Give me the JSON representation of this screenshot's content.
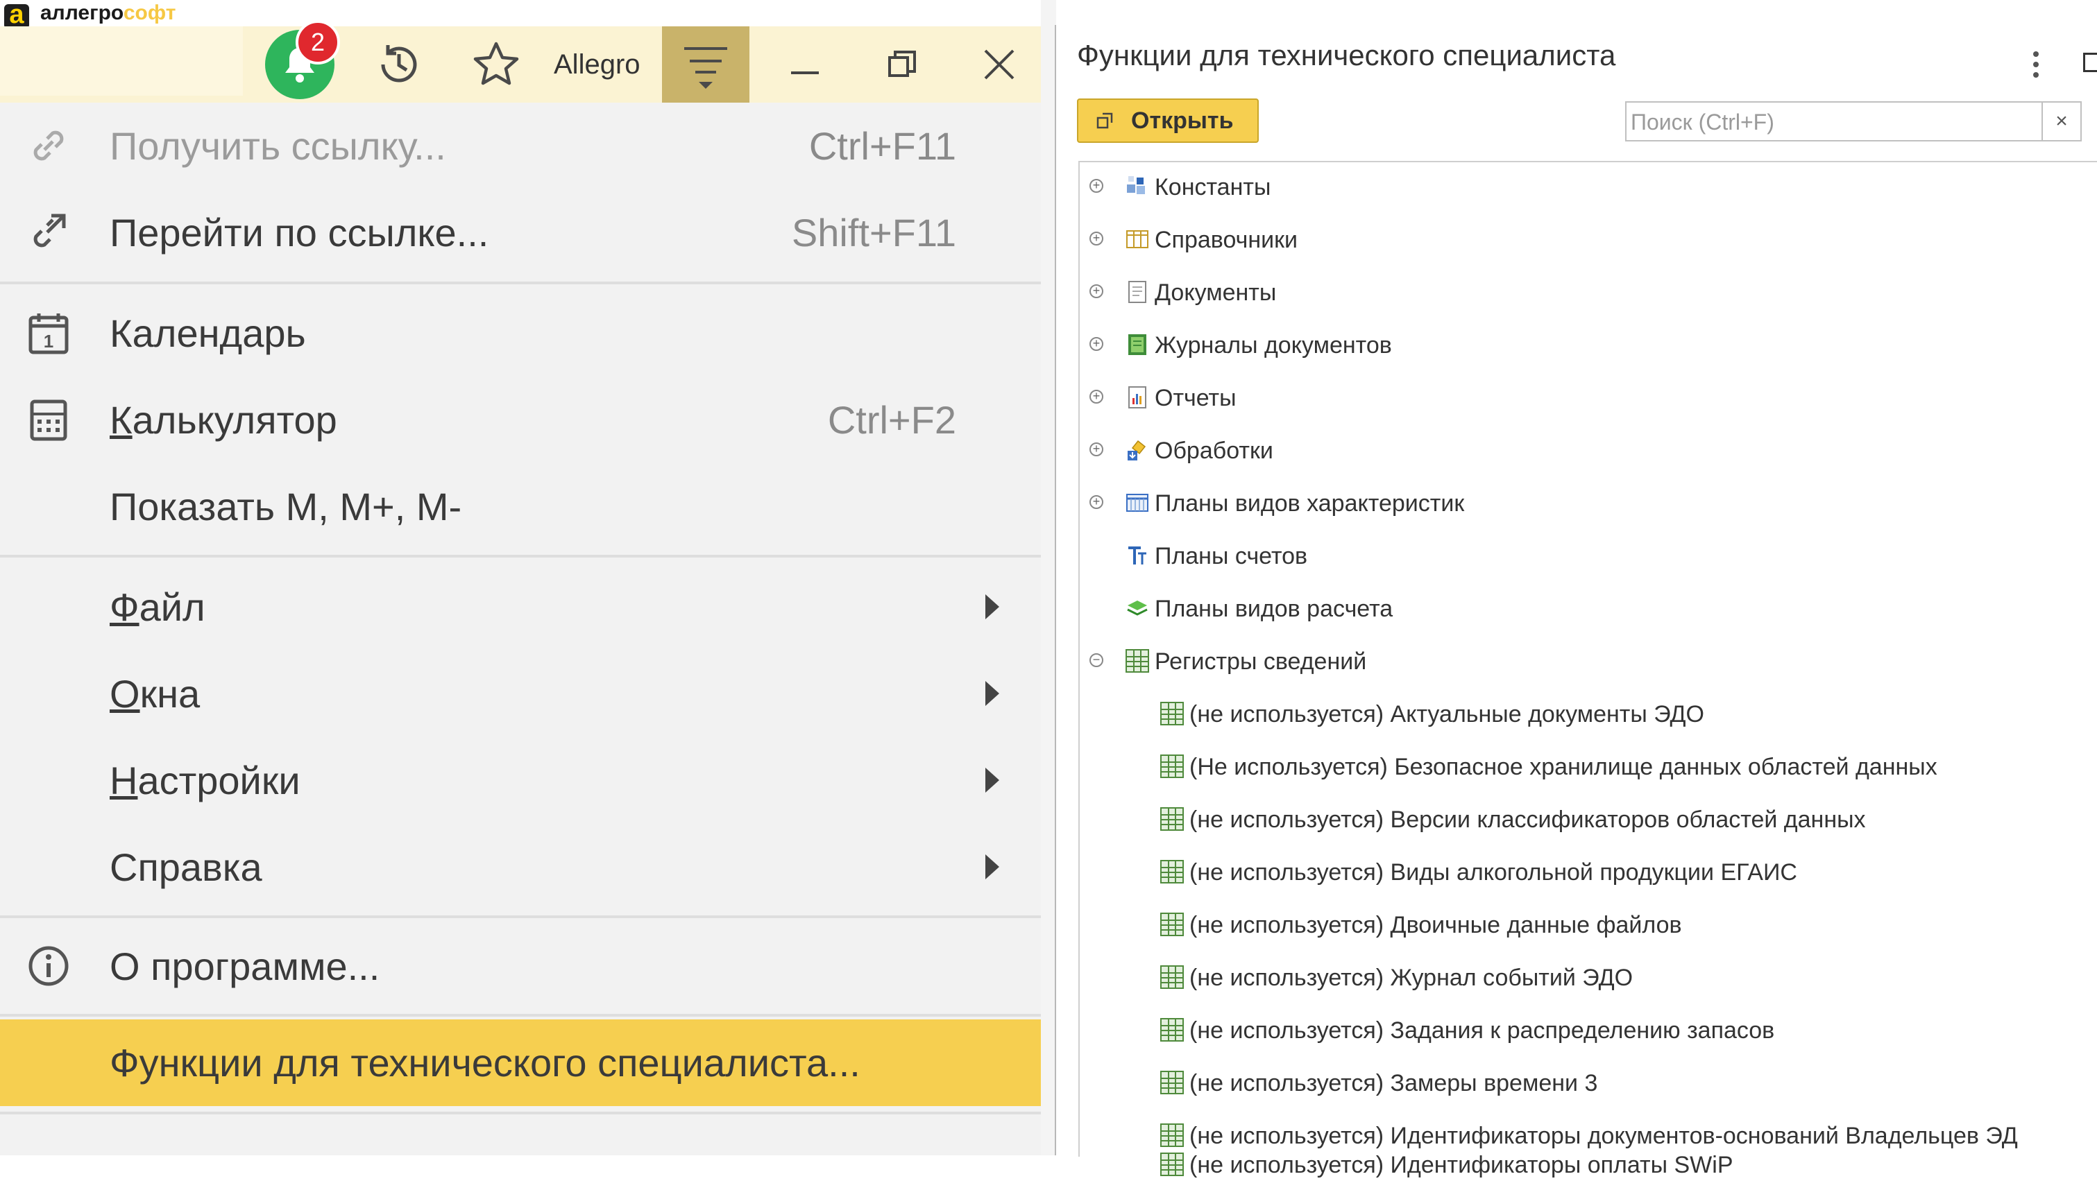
{
  "brand": {
    "logo_glyph": "a",
    "name_main": "аллегро",
    "name_accent": "софт"
  },
  "toolbar": {
    "notifications_count": "2",
    "app_label": "Allegro"
  },
  "menu": {
    "items": [
      {
        "label": "Получить ссылку...",
        "shortcut": "Ctrl+F11",
        "icon": "link-icon"
      },
      {
        "label": "Перейти по ссылке...",
        "shortcut": "Shift+F11",
        "icon": "follow-link-icon"
      },
      {
        "label": "Календарь",
        "shortcut": "",
        "icon": "calendar-icon"
      },
      {
        "label": "Калькулятор",
        "shortcut": "Ctrl+F2",
        "icon": "calculator-icon"
      },
      {
        "label": "Показать M, M+, M-",
        "shortcut": "",
        "icon": ""
      },
      {
        "label": "Файл",
        "submenu": true
      },
      {
        "label": "Окна",
        "submenu": true
      },
      {
        "label": "Настройки",
        "submenu": true
      },
      {
        "label": "Справка",
        "submenu": true
      },
      {
        "label": "О программе...",
        "icon": "info-icon"
      },
      {
        "label": "Функции для технического специалиста..."
      }
    ]
  },
  "panel": {
    "title": "Функции для технического специалиста",
    "open_button": "Открыть",
    "search_placeholder": "Поиск (Ctrl+F)",
    "search_clear": "×",
    "tree": [
      {
        "label": "Константы",
        "expand": "+",
        "icon": "constants-icon"
      },
      {
        "label": "Справочники",
        "expand": "+",
        "icon": "catalogs-icon"
      },
      {
        "label": "Документы",
        "expand": "+",
        "icon": "documents-icon"
      },
      {
        "label": "Журналы документов",
        "expand": "+",
        "icon": "journals-icon"
      },
      {
        "label": "Отчеты",
        "expand": "+",
        "icon": "reports-icon"
      },
      {
        "label": "Обработки",
        "expand": "+",
        "icon": "processing-icon"
      },
      {
        "label": "Планы видов характеристик",
        "expand": "+",
        "icon": "characteristics-icon"
      },
      {
        "label": "Планы счетов",
        "expand": "",
        "icon": "chart-of-accounts-icon"
      },
      {
        "label": "Планы видов расчета",
        "expand": "",
        "icon": "calculation-types-icon"
      },
      {
        "label": "Регистры сведений",
        "expand": "−",
        "icon": "registers-icon"
      },
      {
        "label": "(не используется) Актуальные документы ЭДО",
        "child": true
      },
      {
        "label": "(Не используется) Безопасное хранилище данных областей данных",
        "child": true
      },
      {
        "label": "(не используется) Версии классификаторов областей данных",
        "child": true
      },
      {
        "label": "(не используется) Виды алкогольной продукции ЕГАИС",
        "child": true
      },
      {
        "label": "(не используется) Двоичные данные файлов",
        "child": true
      },
      {
        "label": "(не используется) Журнал событий ЭДО",
        "child": true
      },
      {
        "label": "(не используется) Задания к распределению запасов",
        "child": true
      },
      {
        "label": "(не используется) Замеры времени 3",
        "child": true
      },
      {
        "label": "(не используется) Идентификаторы документов-оснований Владельцев ЭД",
        "child": true
      },
      {
        "label": "(не используется) Идентификаторы оплаты SWiP",
        "child": true
      }
    ]
  }
}
